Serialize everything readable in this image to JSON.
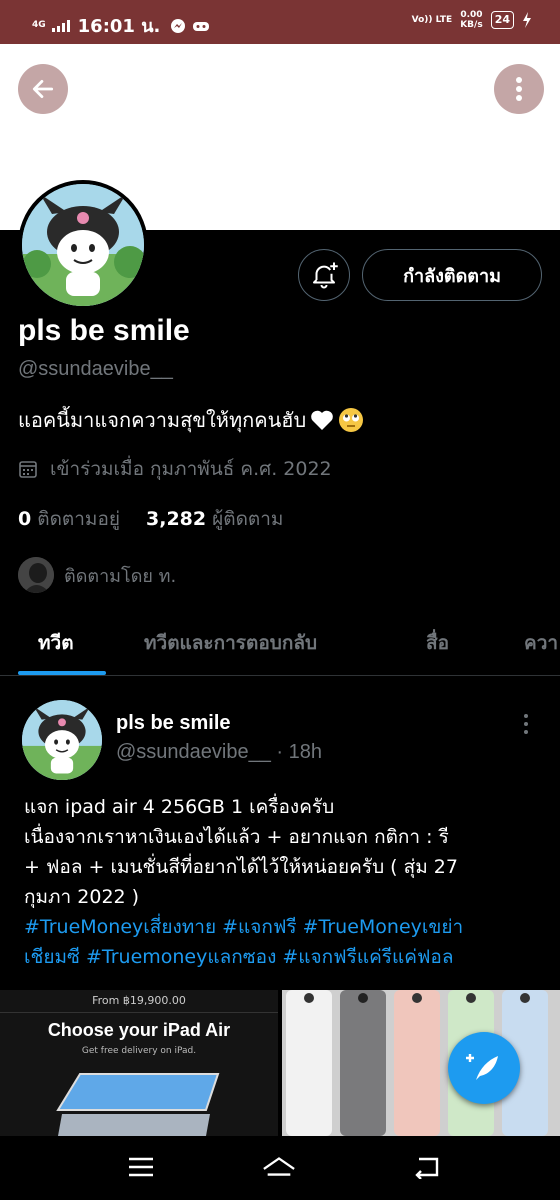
{
  "status_bar": {
    "network": "4G",
    "time": "16:01 น.",
    "volte": "Vo)) LTE",
    "speed_value": "0.00",
    "speed_unit": "KB/s",
    "battery": "24"
  },
  "profile": {
    "display_name": "pls be smile",
    "handle": "@ssundaevibe__",
    "bio": "แอคนี้มาแจกความสุขให้ทุกคนฮับ",
    "bio_emojis": [
      "white-heart",
      "rolling-eyes-face"
    ],
    "joined": "เข้าร่วมเมื่อ กุมภาพันธ์ ค.ศ. 2022",
    "following_count": "0",
    "following_label": "ติดตามอยู่",
    "followers_count": "3,282",
    "followers_label": "ผู้ติดตาม",
    "followed_by": "ติดตามโดย ท.",
    "follow_button": "กำลังติดตาม"
  },
  "tabs": [
    {
      "label": "ทวีต",
      "active": true
    },
    {
      "label": "ทวีตและการตอบกลับ",
      "active": false
    },
    {
      "label": "สื่อ",
      "active": false
    },
    {
      "label": "ควา",
      "active": false
    }
  ],
  "tweet": {
    "name": "pls be smile",
    "handle_time": "@ssundaevibe__ · 18h",
    "text_lines": [
      "แจก ipad air 4 256GB 1 เครื่องครับ",
      "เนื่องจากเราหาเงินเองได้แล้ว + อยากแจก กติกา : รี",
      "+ ฟอล + เมนชั่นสีที่อยากได้ไว้ให้หน่อยครับ ( สุ่ม 27",
      "กุมภา 2022 )"
    ],
    "hashtag_lines": [
      "#TrueMoneyเสี่ยงทาย #แจกฟรี #TrueMoneyเขย่า",
      "เชียมซี  #Truemoneyแลกซอง #แจกฟรีแค่รีแค่ฟอล"
    ],
    "media": {
      "price": "From ฿19,900.00",
      "title": "Choose your iPad Air",
      "subtitle": "Get free delivery on iPad."
    }
  },
  "colors": {
    "status_bar": "#7a3434",
    "accent": "#1d9bf0",
    "muted_text": "#71767b",
    "header_button": "#c4a6a6"
  },
  "icons": {
    "back": "arrow-left-icon",
    "more": "more-vertical-icon",
    "bell": "bell-plus-icon",
    "calendar": "calendar-icon",
    "compose": "compose-feather-icon",
    "nav": [
      "menu-icon",
      "home-icon",
      "back-icon"
    ]
  }
}
